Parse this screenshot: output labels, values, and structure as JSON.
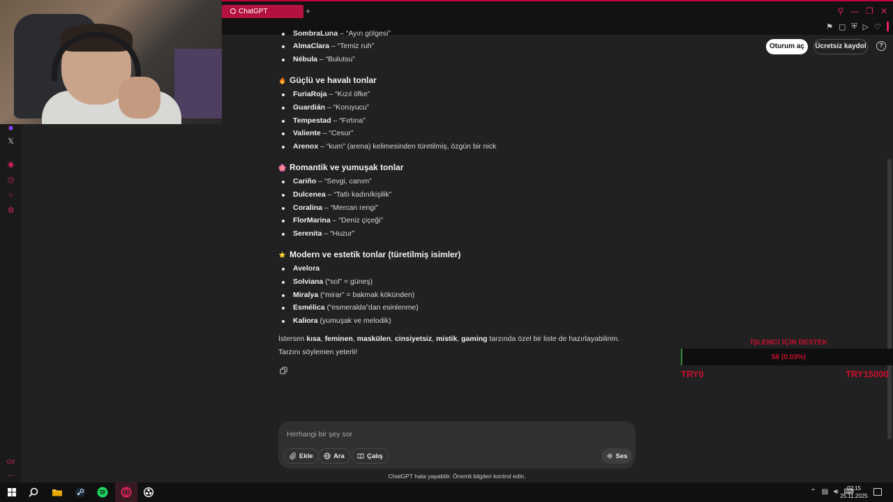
{
  "browser": {
    "tab_title": "ChatGPT",
    "new_tab": "+"
  },
  "header": {
    "login_label": "Oturum aç",
    "signup_label": "Ücretsiz kaydol",
    "help_label": "?"
  },
  "content": {
    "top_items": [
      {
        "name": "SombraLuna",
        "desc": " – “Ayın gölgesi”"
      },
      {
        "name": "AlmaClara",
        "desc": " – “Temiz ruh”"
      },
      {
        "name": "Nébula",
        "desc": " – “Bulutsu”"
      }
    ],
    "sections": [
      {
        "icon": "fire-emoji",
        "title": "Güçlü ve havalı tonlar",
        "items": [
          {
            "name": "FuriaRoja",
            "desc": " – “Kızıl öfke”"
          },
          {
            "name": "Guardián",
            "desc": " – “Koruyucu”"
          },
          {
            "name": "Tempestad",
            "desc": " – “Fırtına”"
          },
          {
            "name": "Valiente",
            "desc": " – “Cesur”"
          },
          {
            "name": "Arenox",
            "desc": " – “kum” (arena) kelimesinden türetilmiş, özgün bir nick"
          }
        ]
      },
      {
        "icon": "flower-emoji",
        "title": "Romantik ve yumuşak tonlar",
        "items": [
          {
            "name": "Cariño",
            "desc": " – “Sevgi, canım”"
          },
          {
            "name": "Dulcenea",
            "desc": " – “Tatlı kadın/kişilik”"
          },
          {
            "name": "Coralina",
            "desc": " – “Mercan rengi”"
          },
          {
            "name": "FlorMarina",
            "desc": " – “Deniz çiçeği”"
          },
          {
            "name": "Serenita",
            "desc": " – “Huzur”"
          }
        ]
      },
      {
        "icon": "star-emoji",
        "title": "Modern ve estetik tonlar (türetilmiş isimler)",
        "items": [
          {
            "name": "Avelora",
            "desc": ""
          },
          {
            "name": "Solviana",
            "desc": " (“sol” = güneş)"
          },
          {
            "name": "Miralya",
            "desc": " (“mirar” = bakmak kökünden)"
          },
          {
            "name": "Esmélica",
            "desc": " (“esmeralda”dan esinlenme)"
          },
          {
            "name": "Kaliora",
            "desc": " (yumuşak ve melodik)"
          }
        ]
      }
    ],
    "closing": {
      "t1": "İstersen ",
      "k1": "kısa",
      "t2": ", ",
      "k2": "feminen",
      "t3": ", ",
      "k3": "maskülen",
      "t4": ", ",
      "k4": "cinsiyetsiz",
      "t5": ", ",
      "k5": "mistik",
      "t6": ", ",
      "k6": "gaming",
      "t7": " tarzında özel bir liste de hazırlayabilirim. Tarzını söylemen yeterli!"
    }
  },
  "composer": {
    "placeholder": "Herhangi bir şey sor",
    "add_label": "Ekle",
    "search_label": "Ara",
    "study_label": "Çalış",
    "voice_label": "Ses"
  },
  "disclaimer": "ChatGPT hata yapabilir. Önemli bilgileri kontrol edin.",
  "overlay": {
    "title": "İŞLEMCI İÇİN DESTEK",
    "value": "56 (0.03%)",
    "min": "TRY0",
    "max": "TRY15000"
  },
  "taskbar": {
    "time": "02:15",
    "date": "25.11.2025"
  },
  "colors": {
    "accent": "#c8102e",
    "tab": "#b3123f",
    "background": "#212121"
  }
}
